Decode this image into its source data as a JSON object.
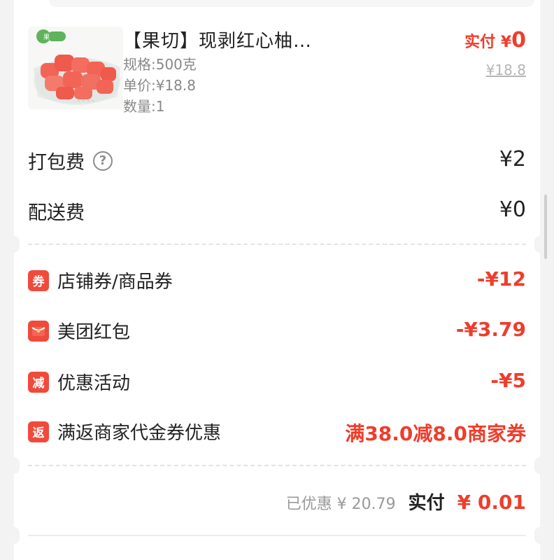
{
  "product": {
    "title": "【果切】现剥红心柚…",
    "spec": "规格:500克",
    "unit_price": "单价:¥18.8",
    "quantity": "数量:1",
    "paid_label": "实付 ¥",
    "paid_amount": "0",
    "original_price": "¥18.8",
    "image_icon": "pomelo-fruit-cup-image"
  },
  "fees": {
    "packing": {
      "label": "打包费",
      "value": "¥2",
      "help_glyph": "?"
    },
    "delivery": {
      "label": "配送费",
      "value": "¥0"
    }
  },
  "discounts": [
    {
      "icon_text": "券",
      "label": "店铺券/商品券",
      "value": "-¥12"
    },
    {
      "icon_text": "",
      "icon_name": "red-packet-icon",
      "label": "美团红包",
      "value": "-¥3.79"
    },
    {
      "icon_text": "减",
      "label": "优惠活动",
      "value": "-¥5"
    },
    {
      "icon_text": "返",
      "label": "满返商家代金券优惠",
      "value": "满38.0减8.0商家券"
    }
  ],
  "summary": {
    "saved": "已优惠 ¥ 20.79",
    "total_label": "实付",
    "total_value": "¥ 0.01"
  },
  "colors": {
    "accent": "#ef3d2b",
    "text": "#222222",
    "muted": "#888888",
    "background": "#f3f3f3"
  }
}
